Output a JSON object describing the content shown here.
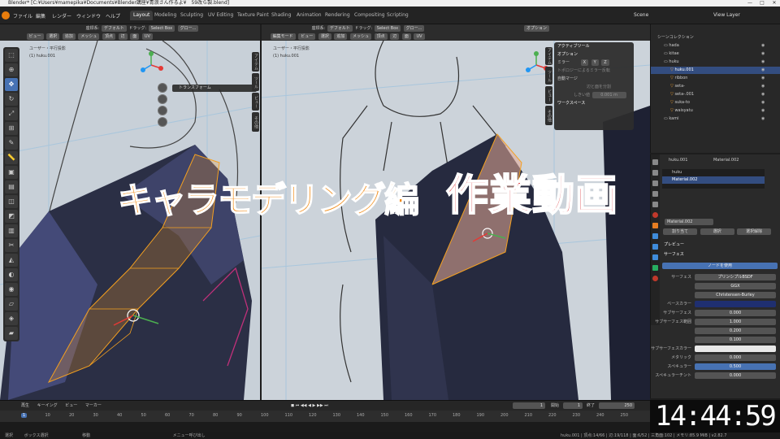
{
  "window": {
    "title": "Blender* [C:¥Users¥mamepika¥Documents¥Blender講座¥青浪さん作るよ¥　59改ら製.blend]",
    "min": "—",
    "max": "□",
    "close": "✕"
  },
  "menu": [
    "ファイル",
    "編集",
    "レンダー",
    "ウィンドウ",
    "ヘルプ"
  ],
  "workspaces": [
    "Layout",
    "Modeling",
    "Sculpting",
    "UV Editing",
    "Texture Paint",
    "Shading",
    "Animation",
    "Rendering",
    "Compositing",
    "Scripting"
  ],
  "active_workspace": "Layout",
  "scene": "Scene",
  "view_layer": "View Layer",
  "left_view": {
    "header": [
      "ビュー",
      "選択",
      "追加",
      "メッシュ",
      "頂点",
      "辺",
      "面",
      "UV"
    ],
    "transform_label": "座標系:",
    "transform_value": "デフォルト",
    "drag_label": "ドラッグ:",
    "select_box": "Select Box",
    "pivot": "グロー...",
    "view_name": "ユーザー・平行投影",
    "object_name": "(1) huku.001",
    "popup": "トランスフォーム"
  },
  "right_view": {
    "mode": "編集モード",
    "header": [
      "ビュー",
      "選択",
      "追加",
      "メッシュ",
      "頂点",
      "辺",
      "面",
      "UV"
    ],
    "transform_label": "座標系:",
    "transform_value": "デフォルト",
    "drag_label": "ドラッグ:",
    "select_box": "Select Box",
    "pivot": "グロー...",
    "options": "オプション",
    "view_name": "ユーザー・平行投影",
    "object_name": "(1) huku.001"
  },
  "npanel": {
    "active_tool": "アクティブツール",
    "options": "オプション",
    "mirror": "ミラー",
    "axes": [
      "X",
      "Y",
      "Z"
    ],
    "topology": "トポロジーによるミラー反転",
    "automerge": "自動マージ",
    "split": "辺と面を分割",
    "threshold_label": "しきい値",
    "threshold_value": "0.001 m",
    "workspace": "ワークスペース"
  },
  "side_tabs_left": [
    "アイテム",
    "ツール",
    "ビュー",
    "その他"
  ],
  "side_tabs_right": [
    "アイテム",
    "ツール",
    "ビュー",
    "その他"
  ],
  "overlay": {
    "line1": "キャラモデリング編",
    "line2": "作業動画"
  },
  "outliner": {
    "root": "シーンコレクション",
    "items": [
      {
        "name": "hada",
        "indent": 1
      },
      {
        "name": "kitae",
        "indent": 1
      },
      {
        "name": "huku",
        "indent": 1
      },
      {
        "name": "huku.001",
        "indent": 2,
        "selected": true
      },
      {
        "name": "ribbon",
        "indent": 2
      },
      {
        "name": "seta-",
        "indent": 2
      },
      {
        "name": "seta-.001",
        "indent": 2
      },
      {
        "name": "suka-to",
        "indent": 2
      },
      {
        "name": "waisyatu",
        "indent": 2
      },
      {
        "name": "kami",
        "indent": 1
      }
    ]
  },
  "properties": {
    "object": "huku.001",
    "material_tab": "Material.002",
    "slots": [
      "huku",
      "Material.002"
    ],
    "material_name": "Material.002",
    "buttons": [
      "割り当て",
      "選択",
      "選択解除"
    ],
    "preview": "プレビュー",
    "surface": "サーフェス",
    "use_nodes": "ノードを使用",
    "rows": [
      {
        "label": "サーフェス",
        "value": "プリンシプルBSDF"
      },
      {
        "label": "",
        "value": "GGX"
      },
      {
        "label": "",
        "value": "Christensen-Burley"
      },
      {
        "label": "ベースカラー",
        "value": ""
      },
      {
        "label": "サブサーフェス",
        "value": "0.000"
      },
      {
        "label": "サブサーフェス範囲",
        "value": "1.000"
      },
      {
        "label": "",
        "value": "0.200"
      },
      {
        "label": "",
        "value": "0.100"
      },
      {
        "label": "サブサーフェスカラー",
        "value": ""
      },
      {
        "label": "メタリック",
        "value": "0.000"
      },
      {
        "label": "スペキュラー",
        "value": "0.500"
      },
      {
        "label": "スペキュラーチント",
        "value": "0.000"
      }
    ]
  },
  "timeline": {
    "menu": [
      "再生",
      "キーイング",
      "ビュー",
      "マーカー"
    ],
    "current_frame": "1",
    "start_label": "開始",
    "start": "1",
    "end_label": "終了",
    "end": "250",
    "ticks": [
      "1",
      "10",
      "20",
      "30",
      "40",
      "50",
      "60",
      "70",
      "80",
      "90",
      "100",
      "110",
      "120",
      "130",
      "140",
      "150",
      "160",
      "170",
      "180",
      "190",
      "200",
      "210",
      "220",
      "230",
      "240",
      "250"
    ]
  },
  "statusbar": {
    "select": "選択",
    "box_select": "ボックス選択",
    "move": "移動",
    "context": "メニュー呼び出し",
    "stats": "huku.001 | 頂点:14/66 | 辺:19/118 | 面:6/52 | 三角面:102 | メモリ:85.9 MiB | v2.82.7"
  },
  "clock": "14:44:59",
  "colors": {
    "accent": "#4772b3",
    "overlay_orange": "#f18a14",
    "overlay_red": "#d8262b",
    "selection": "#334d80",
    "blender_orange": "#e87d0d"
  }
}
